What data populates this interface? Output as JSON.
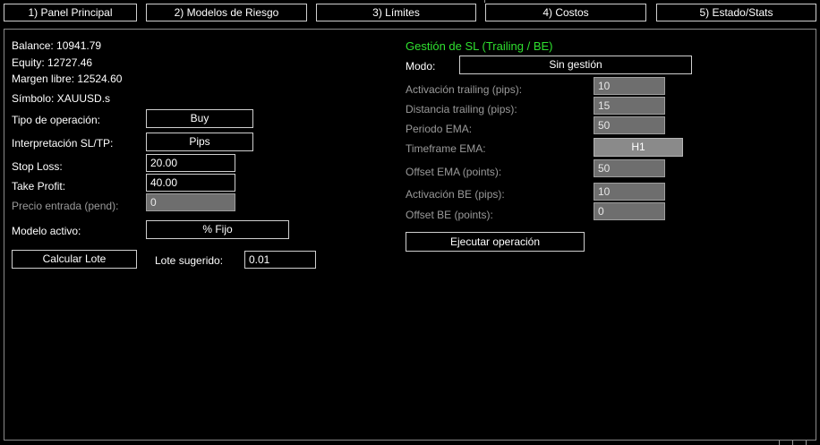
{
  "tabs": [
    {
      "label": "1) Panel Principal"
    },
    {
      "label": "2) Modelos de Riesgo"
    },
    {
      "label": "3) Límites"
    },
    {
      "label": "4) Costos"
    },
    {
      "label": "5) Estado/Stats"
    }
  ],
  "account": {
    "balance": "Balance: 10941.79",
    "equity": "Equity: 12727.46",
    "free_margin": "Margen libre: 12524.60",
    "symbol": "Símbolo: XAUUSD.s"
  },
  "order": {
    "type_label": "Tipo de operación:",
    "type_value": "Buy",
    "interp_label": "Interpretación SL/TP:",
    "interp_value": "Pips",
    "sl_label": "Stop Loss:",
    "sl_value": "20.00",
    "tp_label": "Take Profit:",
    "tp_value": "40.00",
    "entry_label": "Precio entrada (pend):",
    "entry_value": "0",
    "model_label": "Modelo activo:",
    "model_value": "% Fijo",
    "calc_button": "Calcular Lote",
    "lot_label": "Lote sugerido:",
    "lot_value": "0.01"
  },
  "sl_mgmt": {
    "title": "Gestión de SL (Trailing / BE)",
    "mode_label": "Modo:",
    "mode_value": "Sin gestión",
    "trail_act_label": "Activación trailing (pips):",
    "trail_act_value": "10",
    "trail_dist_label": "Distancia trailing (pips):",
    "trail_dist_value": "15",
    "ema_period_label": "Periodo EMA:",
    "ema_period_value": "50",
    "ema_tf_label": "Timeframe EMA:",
    "ema_tf_value": "H1",
    "ema_offset_label": "Offset EMA (points):",
    "ema_offset_value": "50",
    "be_act_label": "Activación BE (pips):",
    "be_act_value": "10",
    "be_offset_label": "Offset BE (points):",
    "be_offset_value": "0",
    "execute_button": "Ejecutar operación"
  },
  "colors": {
    "background": "#000000",
    "accent_green": "#2fe02f",
    "disabled_text": "#9a9a9a"
  }
}
